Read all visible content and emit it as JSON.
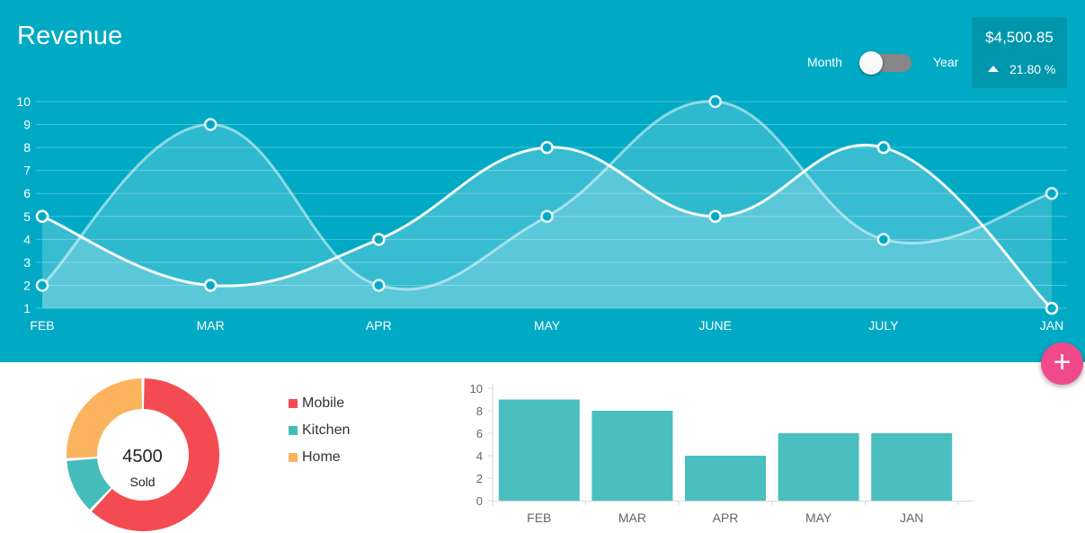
{
  "header": {
    "title": "Revenue",
    "toggle": {
      "left_label": "Month",
      "right_label": "Year",
      "state": "Month"
    },
    "stat": {
      "amount": "$4,500.85",
      "change": "21.80 %",
      "trend": "up"
    }
  },
  "fab": {
    "label": "+",
    "icon": "plus-icon"
  },
  "colors": {
    "panel_background": "#00aac5",
    "stat_card": "#0097ad",
    "line_series": "#ffffff",
    "point_fill": "#00aac5",
    "fab": "#f04a8c",
    "bars": "#4bbfbf",
    "mobile": "#f44b52",
    "kitchen": "#46bdba",
    "home": "#fbb45d"
  },
  "chart_data": [
    {
      "type": "area",
      "title": "Revenue",
      "categories": [
        "FEB",
        "MAR",
        "APR",
        "MAY",
        "JUNE",
        "JULY",
        "JAN"
      ],
      "series": [
        {
          "values": [
            5,
            2,
            4,
            8,
            5,
            8,
            1
          ]
        },
        {
          "values": [
            2,
            9,
            2,
            5,
            10,
            4,
            6
          ]
        }
      ],
      "ylim": [
        1,
        10
      ],
      "yticks": [
        1,
        2,
        3,
        4,
        5,
        6,
        7,
        8,
        9,
        10
      ],
      "grid": true
    },
    {
      "type": "pie",
      "center_value": "4500",
      "center_label": "Sold",
      "slices": [
        {
          "label": "Mobile",
          "value": 62
        },
        {
          "label": "Kitchen",
          "value": 12
        },
        {
          "label": "Home",
          "value": 26
        }
      ],
      "legend": "right"
    },
    {
      "type": "bar",
      "categories": [
        "FEB",
        "MAR",
        "APR",
        "MAY",
        "JAN"
      ],
      "values": [
        9,
        8,
        4,
        6,
        6
      ],
      "ylim": [
        0,
        10
      ],
      "yticks": [
        0,
        2,
        4,
        6,
        8,
        10
      ],
      "grid": false
    }
  ]
}
